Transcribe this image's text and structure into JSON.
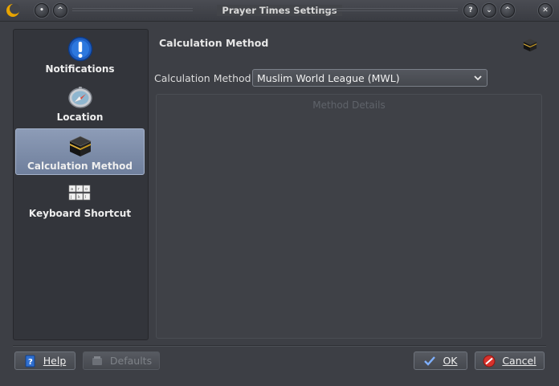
{
  "window": {
    "title": "Prayer Times Settings",
    "icons": [
      "app-crescent-icon",
      "sticky-pin-icon",
      "keep-above-icon",
      "help-icon",
      "minimize-icon",
      "maximize-icon",
      "close-icon"
    ]
  },
  "sidebar": {
    "items": [
      {
        "label": "Notifications",
        "icon": "notification-icon",
        "selected": false
      },
      {
        "label": "Location",
        "icon": "compass-icon",
        "selected": false
      },
      {
        "label": "Calculation Method",
        "icon": "kaaba-icon",
        "selected": true
      },
      {
        "label": "Keyboard Shortcut",
        "icon": "keyboard-icon",
        "selected": false
      }
    ]
  },
  "page": {
    "title": "Calculation Method",
    "method_label": "Calculation Method:",
    "method_value": "Muslim World League (MWL)",
    "details_title": "Method Details"
  },
  "footer": {
    "help": "Help",
    "defaults": "Defaults",
    "ok": "OK",
    "cancel": "Cancel"
  },
  "colors": {
    "background": "#3d3f45",
    "sidebar": "#33353b",
    "selection": "#7c8ba8"
  }
}
